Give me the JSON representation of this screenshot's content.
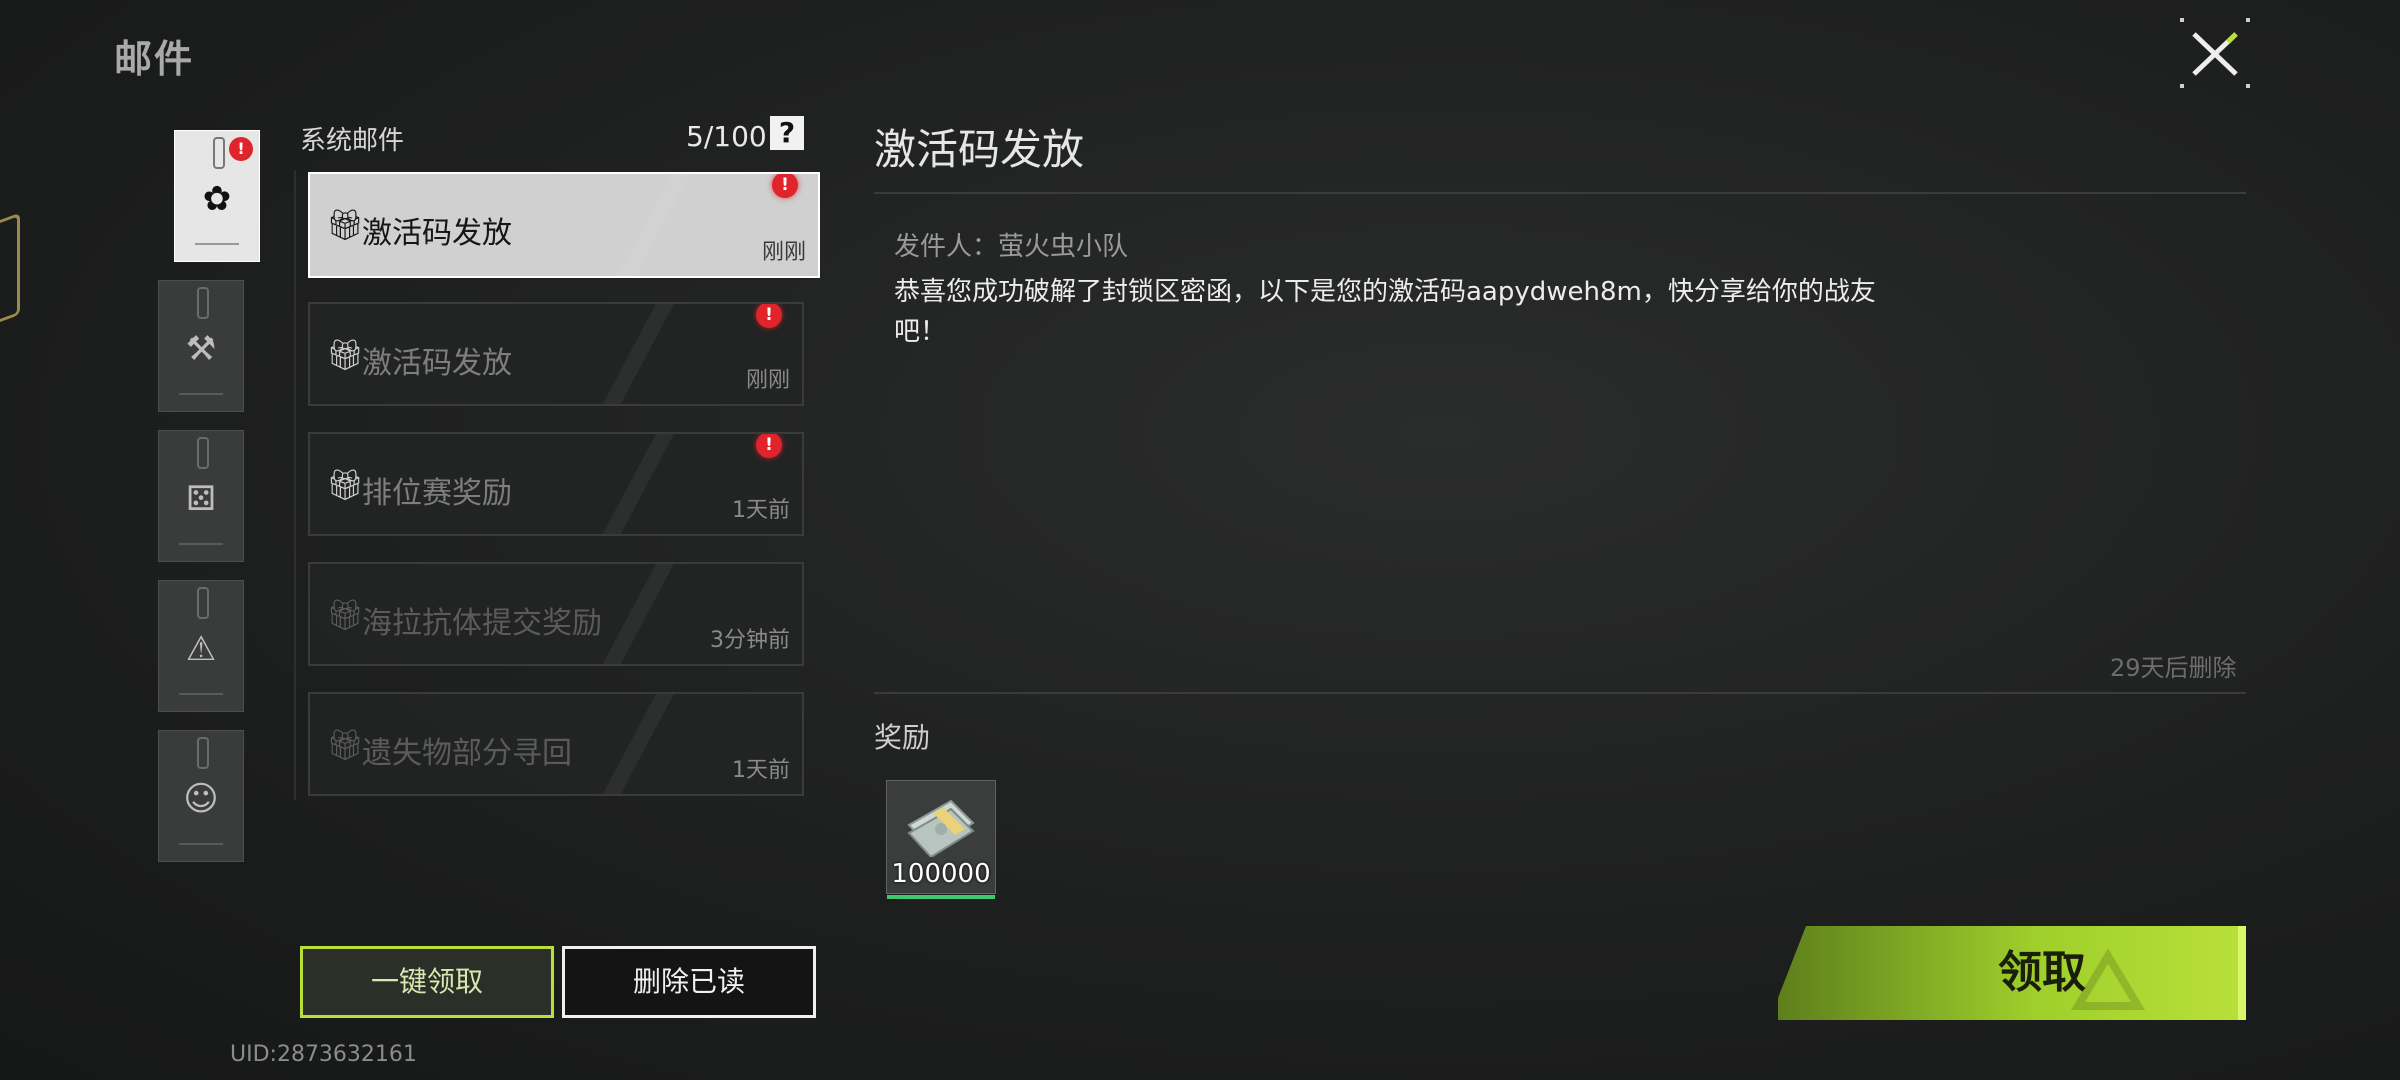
{
  "header": {
    "title": "邮件",
    "close_icon": "close-icon"
  },
  "categories": [
    {
      "name": "system",
      "icon": "gear-icon",
      "active": true,
      "unread_badge": "!"
    },
    {
      "name": "trade",
      "icon": "gavel-icon",
      "active": false
    },
    {
      "name": "friends",
      "icon": "dice-icon",
      "active": false
    },
    {
      "name": "warning",
      "icon": "warning-icon",
      "active": false
    },
    {
      "name": "avatar",
      "icon": "avatar-icon",
      "active": false
    }
  ],
  "mail_list": {
    "title": "系统邮件",
    "count": "5/100",
    "help_label": "?",
    "items": [
      {
        "subject": "激活码发放",
        "time": "刚刚",
        "unread": true,
        "active": true,
        "icon": "gift-icon"
      },
      {
        "subject": "激活码发放",
        "time": "刚刚",
        "unread": true,
        "active": false,
        "icon": "gift-icon"
      },
      {
        "subject": "排位赛奖励",
        "time": "1天前",
        "unread": true,
        "active": false,
        "icon": "gift-icon"
      },
      {
        "subject": "海拉抗体提交奖励",
        "time": "3分钟前",
        "unread": false,
        "active": false,
        "icon": "gift-open-icon"
      },
      {
        "subject": "遗失物部分寻回",
        "time": "1天前",
        "unread": false,
        "active": false,
        "icon": "gift-open-icon"
      }
    ],
    "unread_badge": "!"
  },
  "actions": {
    "claim_all": "一键领取",
    "delete_read": "删除已读"
  },
  "uid": "UID:2873632161",
  "detail": {
    "title": "激活码发放",
    "sender": "发件人：萤火虫小队",
    "body_line1": "恭喜您成功破解了封锁区密函，以下是您的激活码aapydweh8m，快分享给你的战友",
    "body_line2": "吧！",
    "expire": "29天后删除",
    "reward_label": "奖励",
    "rewards": [
      {
        "icon": "cash-bundle-icon",
        "quantity": "100000"
      }
    ],
    "claim_button": "领取"
  },
  "colors": {
    "accent": "#b9df3a",
    "badge": "#e0242b",
    "rarity": "#3fc86d"
  }
}
